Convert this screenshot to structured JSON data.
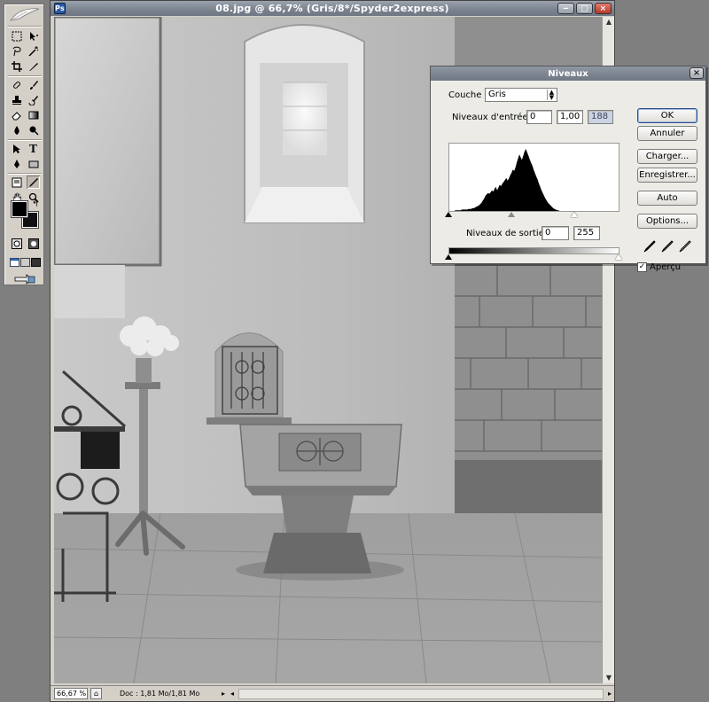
{
  "document": {
    "title": "08.jpg @ 66,7% (Gris/8*/Spyder2express)",
    "status": {
      "zoom": "66,67 %",
      "doc_info": "Doc : 1,81 Mo/1,81 Mo"
    }
  },
  "dialog": {
    "title": "Niveaux",
    "channel_label": "Couche :",
    "channel_value": "Gris",
    "input_levels_label": "Niveaux d'entrée :",
    "input_levels": [
      "0",
      "1,00",
      "188"
    ],
    "output_levels_label": "Niveaux de sortie :",
    "output_levels": [
      "0",
      "255"
    ],
    "input_slider": {
      "black": 0,
      "gamma": 1.0,
      "white": 188
    },
    "output_slider": {
      "black": 0,
      "white": 255
    },
    "buttons": {
      "ok": "OK",
      "cancel": "Annuler",
      "load": "Charger...",
      "save": "Enregistrer...",
      "auto": "Auto",
      "options": "Options..."
    },
    "preview_label": "Aperçu",
    "preview_checked": true,
    "histogram": [
      0,
      0,
      1,
      1,
      1,
      1,
      1,
      2,
      2,
      2,
      2,
      2,
      3,
      3,
      3,
      4,
      4,
      5,
      6,
      7,
      8,
      10,
      12,
      15,
      18,
      22,
      24,
      26,
      25,
      27,
      30,
      28,
      32,
      35,
      30,
      34,
      38,
      36,
      40,
      42,
      45,
      48,
      44,
      47,
      52,
      55,
      60,
      58,
      63,
      70,
      76,
      82,
      78,
      74,
      80,
      86,
      90,
      85,
      80,
      75,
      70,
      66,
      60,
      55,
      50,
      46,
      40,
      35,
      30,
      26,
      22,
      18,
      15,
      12,
      10,
      8,
      6,
      4,
      3,
      2,
      1,
      1,
      0,
      0
    ]
  },
  "colors": {
    "desktop": "#7f7f7f",
    "chrome": "#d4d0c8",
    "titlebar": "#7a828e",
    "dialog_bg": "#ecebe6",
    "foreground_color": "#000000",
    "background_color": "#111111"
  }
}
